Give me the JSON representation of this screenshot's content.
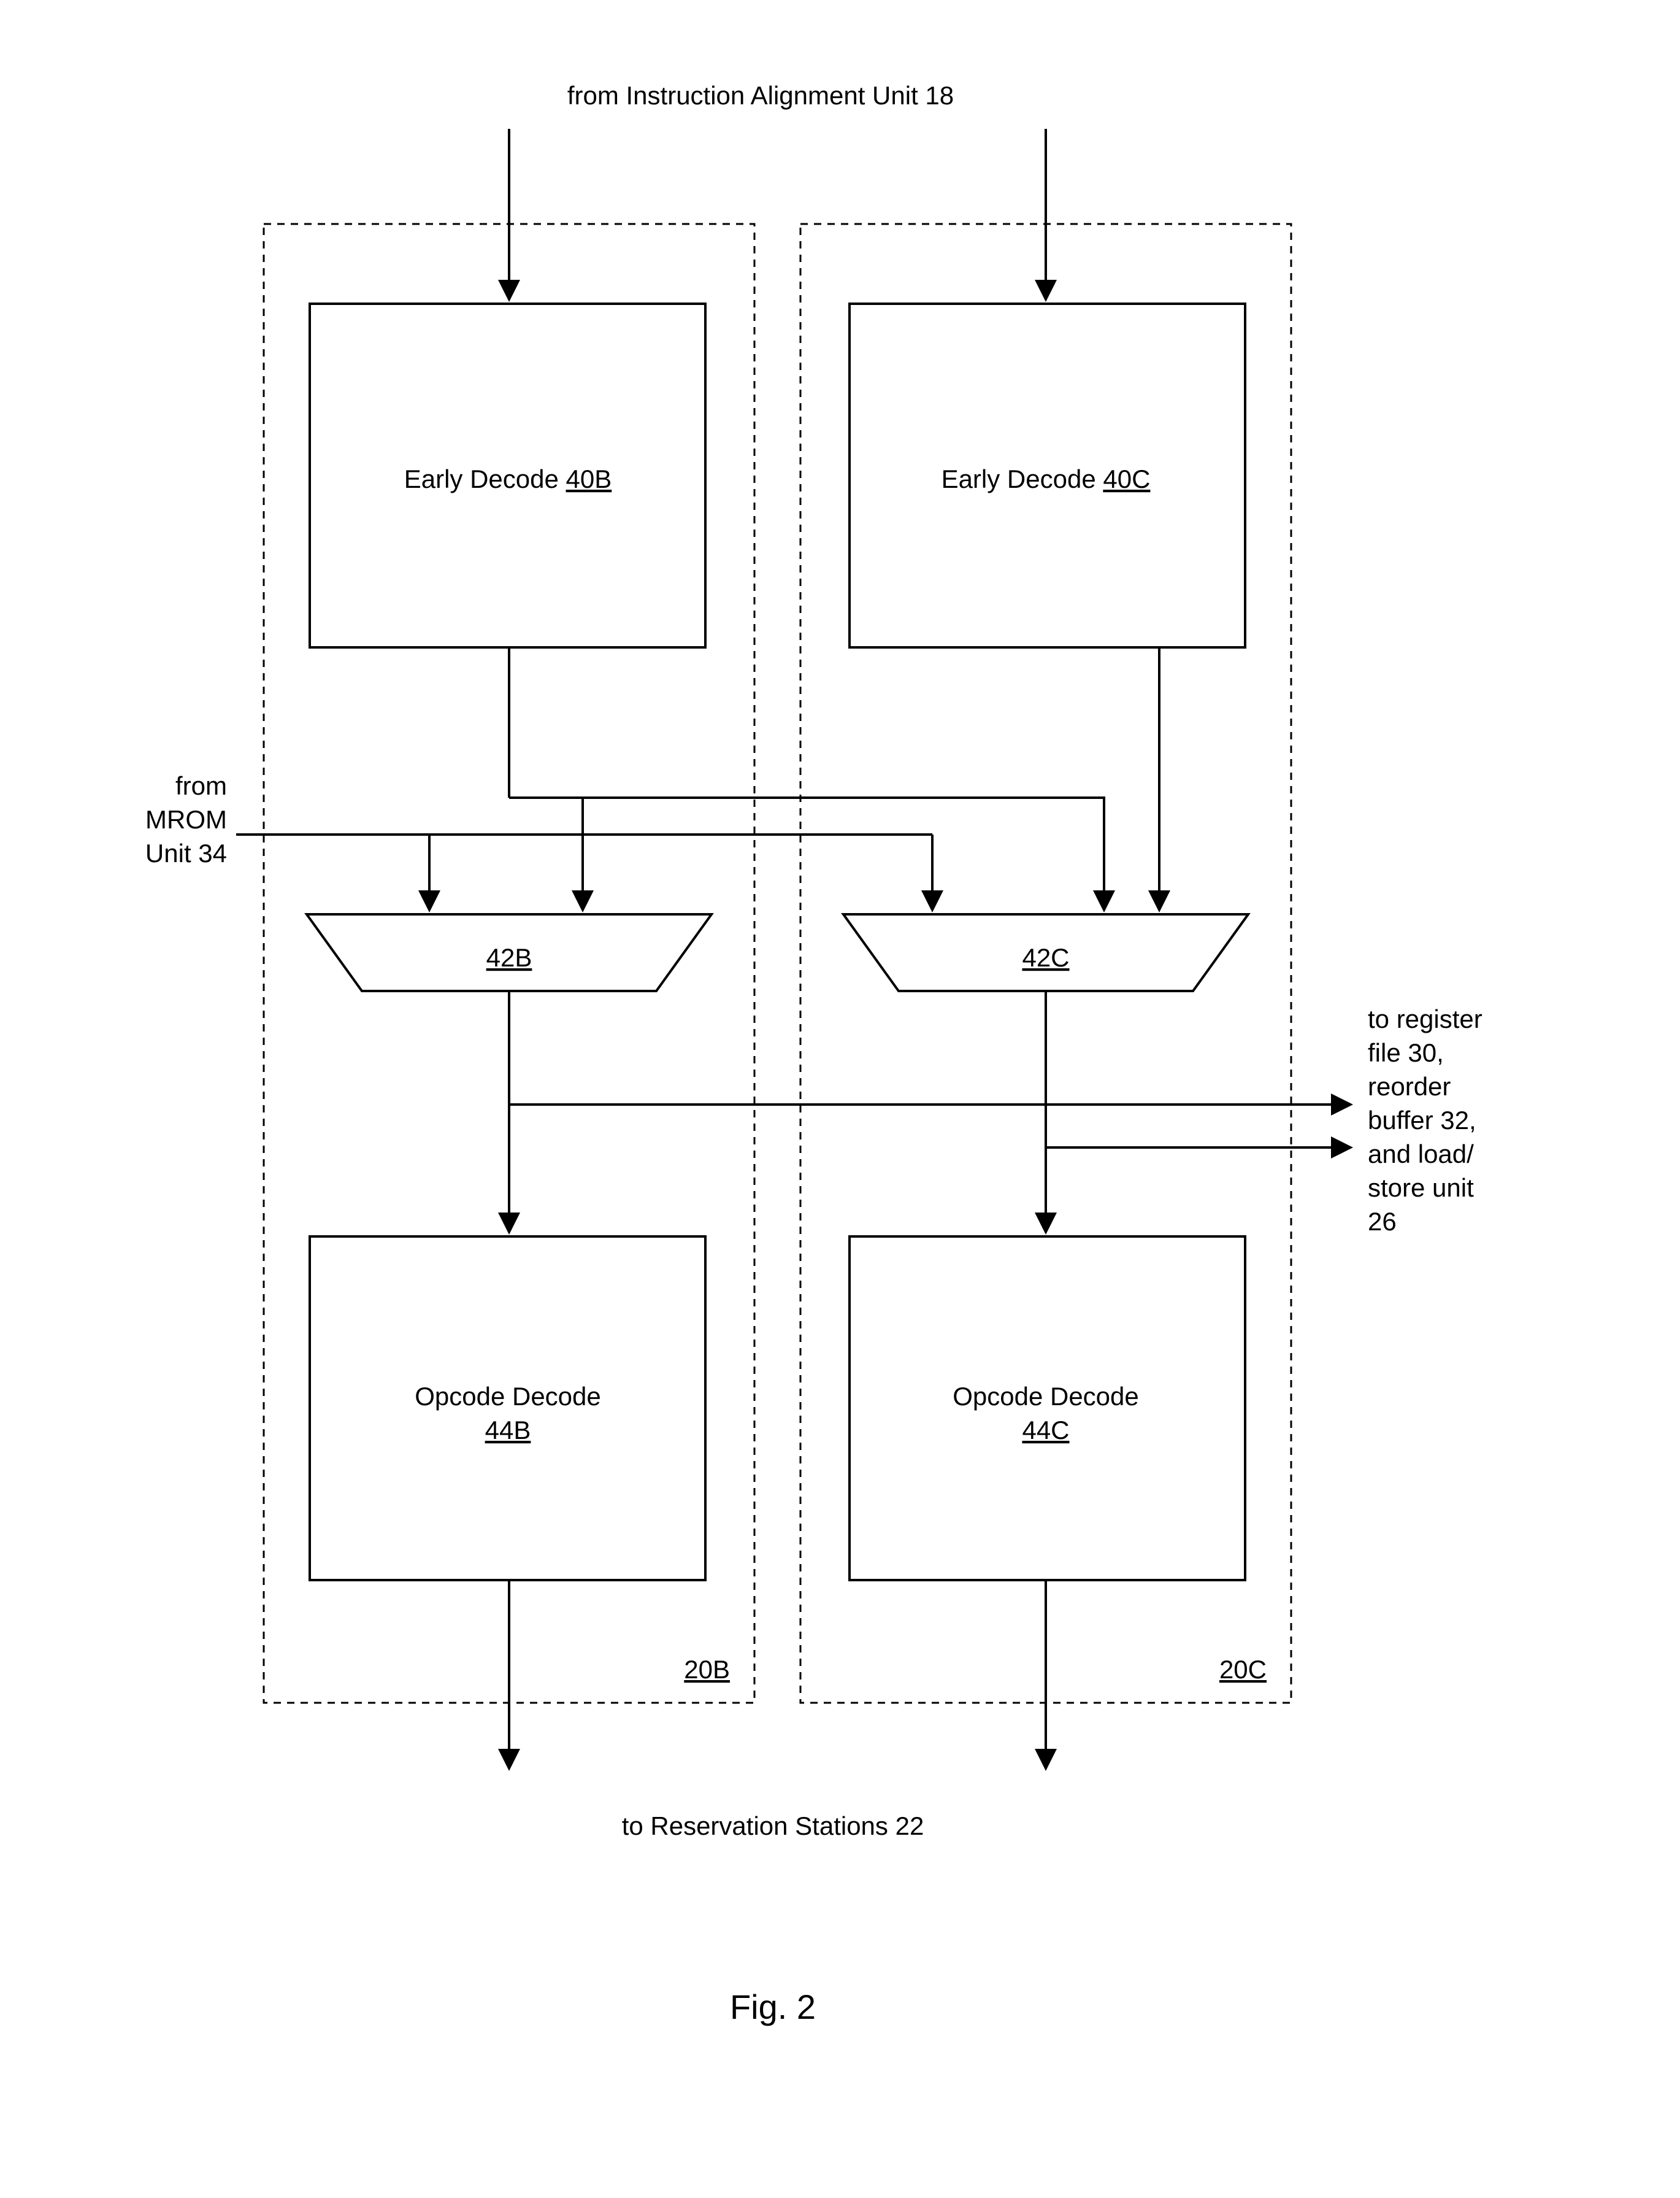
{
  "title_top": "from Instruction Alignment Unit 18",
  "title_bottom": "to Reservation Stations 22",
  "figure_caption": "Fig. 2",
  "left_label_l1": "from",
  "left_label_l2": "MROM",
  "left_label_l3": "Unit 34",
  "right_label_l1": "to register",
  "right_label_l2": "file 30,",
  "right_label_l3": "reorder",
  "right_label_l4": "buffer 32,",
  "right_label_l5": "and load/",
  "right_label_l6": "store unit",
  "right_label_l7": "26",
  "blocks": {
    "early_b": {
      "text": "Early Decode ",
      "ref": "40B"
    },
    "early_c": {
      "text": "Early Decode ",
      "ref": "40C"
    },
    "mux_b": {
      "ref": "42B"
    },
    "mux_c": {
      "ref": "42C"
    },
    "op_b": {
      "text": "Opcode Decode",
      "ref": "44B"
    },
    "op_c": {
      "text": "Opcode Decode",
      "ref": "44C"
    },
    "panel_b": {
      "ref": "20B"
    },
    "panel_c": {
      "ref": "20C"
    }
  }
}
